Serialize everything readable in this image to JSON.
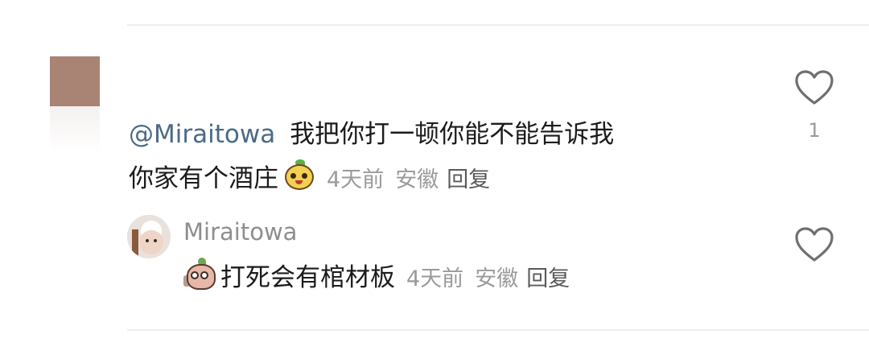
{
  "comment": {
    "mention": "@Miraitowa",
    "text": "我把你打一顿你能不能告诉我你家有个酒庄",
    "time": "4天前",
    "region": "安徽",
    "reply_label": "回复",
    "like_count": "1"
  },
  "reply": {
    "username": "Miraitowa",
    "text": "打死会有棺材板",
    "time": "4天前",
    "region": "安徽",
    "reply_label": "回复"
  },
  "icons": {
    "like": "heart-outline-icon",
    "emoji": "yellow-smiling-fruit-emoji",
    "sticker": "pink-character-sticker-with-glasses"
  },
  "colors": {
    "mention": "#4c6a86",
    "meta": "#9a9a9a",
    "text": "#1b1b1b"
  }
}
